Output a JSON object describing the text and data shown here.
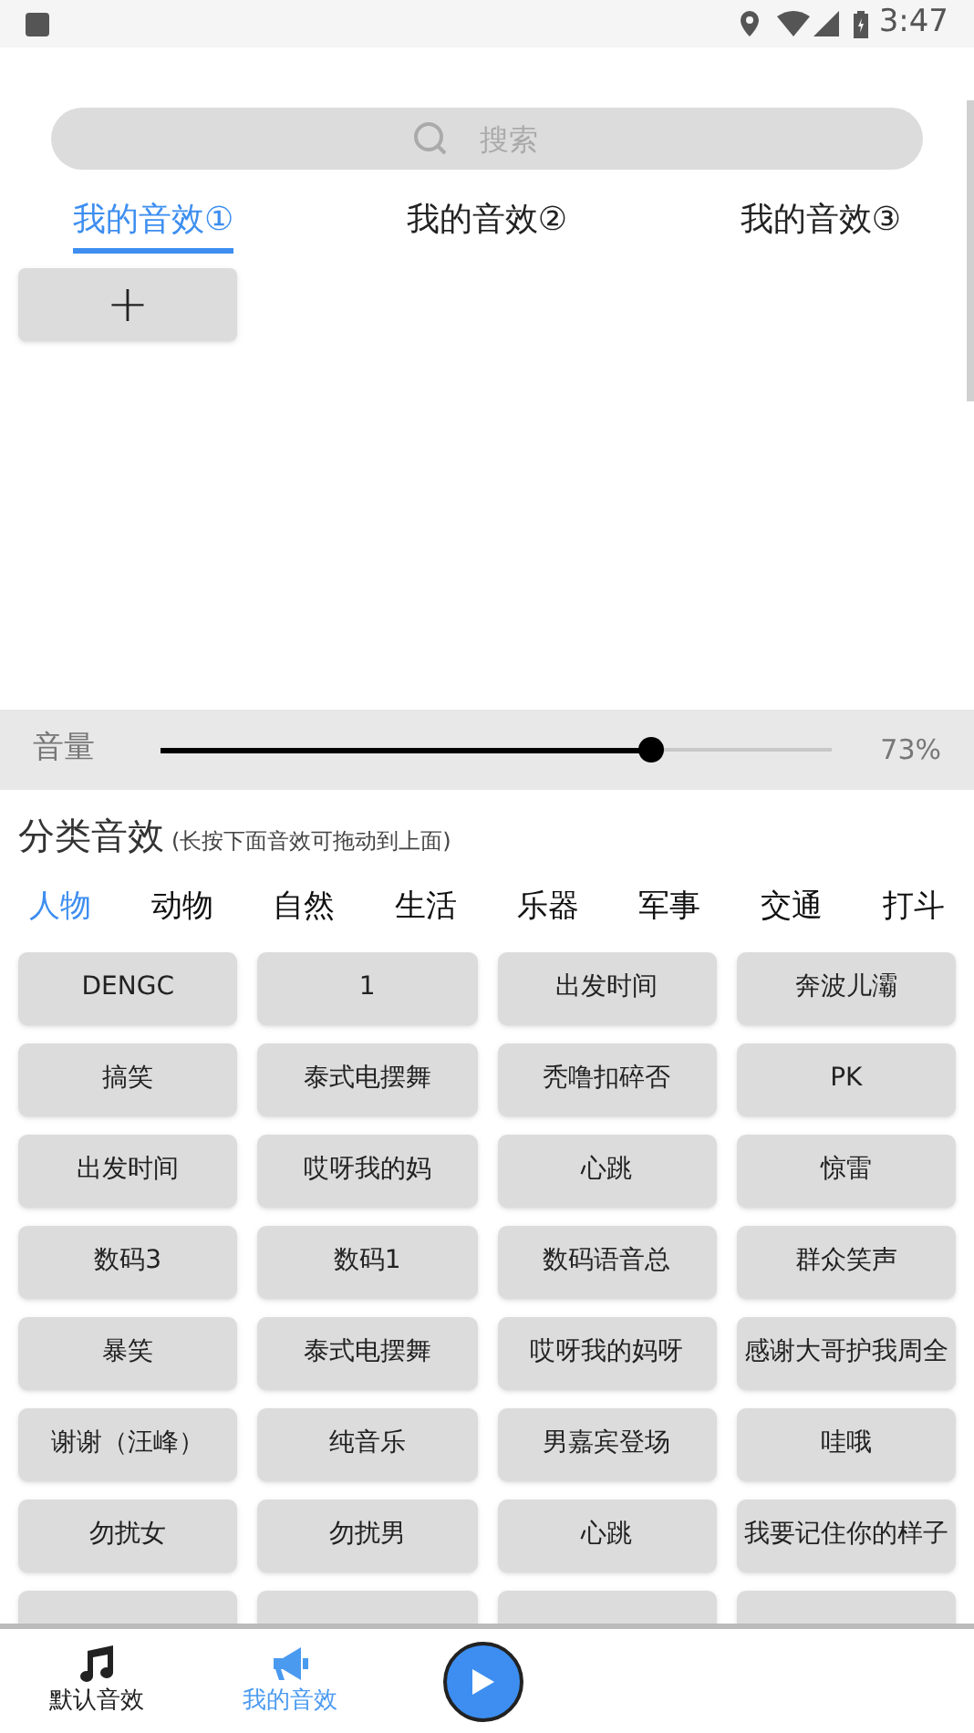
{
  "status_bar": {
    "time": "3:47"
  },
  "search": {
    "placeholder": "搜索"
  },
  "my_tabs": [
    {
      "label": "我的音效①",
      "selected": true
    },
    {
      "label": "我的音效②",
      "selected": false
    },
    {
      "label": "我的音效③",
      "selected": false
    }
  ],
  "add_button": {
    "label": "+"
  },
  "volume": {
    "label": "音量",
    "level": 0.73,
    "reading": "73%"
  },
  "section": {
    "title": "分类音效",
    "hint": "(长按下面音效可拖动到上面)"
  },
  "categories": [
    {
      "label": "人物",
      "selected": true
    },
    {
      "label": "动物",
      "selected": false
    },
    {
      "label": "自然",
      "selected": false
    },
    {
      "label": "生活",
      "selected": false
    },
    {
      "label": "乐器",
      "selected": false
    },
    {
      "label": "军事",
      "selected": false
    },
    {
      "label": "交通",
      "selected": false
    },
    {
      "label": "打斗",
      "selected": false
    }
  ],
  "sounds": [
    {
      "kind": "full",
      "label": "DENGC"
    },
    {
      "kind": "full",
      "label": "1"
    },
    {
      "kind": "full",
      "label": "出发时间"
    },
    {
      "kind": "full",
      "label": "奔波儿灞"
    },
    {
      "kind": "full",
      "label": "搞笑"
    },
    {
      "kind": "full",
      "label": "泰式电摆舞"
    },
    {
      "kind": "full",
      "label": "秃噜扣碎否"
    },
    {
      "kind": "full",
      "label": "PK"
    },
    {
      "kind": "full",
      "label": "出发时间"
    },
    {
      "kind": "full",
      "label": "哎呀我的妈"
    },
    {
      "kind": "full",
      "label": "心跳"
    },
    {
      "kind": "full",
      "label": "惊雷"
    },
    {
      "kind": "full",
      "label": "数码3"
    },
    {
      "kind": "full",
      "label": "数码1"
    },
    {
      "kind": "full",
      "label": "数码语音总"
    },
    {
      "kind": "full",
      "label": "群众笑声"
    },
    {
      "kind": "full",
      "label": "暴笑"
    },
    {
      "kind": "full",
      "label": "泰式电摆舞"
    },
    {
      "kind": "full",
      "label": "哎呀我的妈呀"
    },
    {
      "kind": "full",
      "label": "感谢大哥护我周全"
    },
    {
      "kind": "full",
      "label": "谢谢（汪峰）"
    },
    {
      "kind": "full",
      "label": "纯音乐"
    },
    {
      "kind": "full",
      "label": "男嘉宾登场"
    },
    {
      "kind": "full",
      "label": "哇哦"
    },
    {
      "kind": "full",
      "label": "勿扰女"
    },
    {
      "kind": "full",
      "label": "勿扰男"
    },
    {
      "kind": "full",
      "label": "心跳"
    },
    {
      "kind": "full",
      "label": "我要记住你的样子"
    },
    {
      "kind": "cut"
    },
    {
      "kind": "cut"
    },
    {
      "kind": "cut"
    },
    {
      "kind": "cut"
    }
  ],
  "bottom_nav": [
    {
      "kind": "music",
      "label": "默认音效",
      "selected": false
    },
    {
      "kind": "megaphone",
      "label": "我的音效",
      "selected": true
    },
    {
      "kind": "play"
    }
  ]
}
